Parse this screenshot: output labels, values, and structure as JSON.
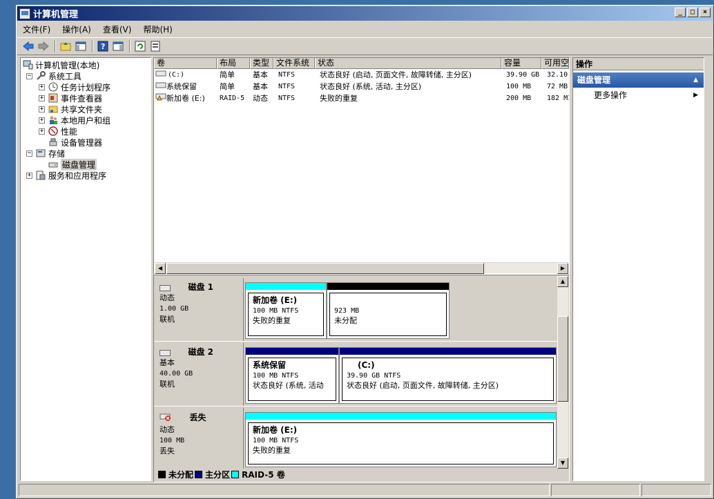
{
  "window": {
    "title": "计算机管理",
    "buttons": [
      "_",
      "□",
      "×"
    ]
  },
  "menu": [
    "文件(F)",
    "操作(A)",
    "查看(V)",
    "帮助(H)"
  ],
  "toolbar": [
    "back-icon",
    "forward-icon",
    "up-folder-icon",
    "show-hide-tree-icon",
    "help-icon",
    "show-hide-action-icon",
    "refresh-icon",
    "properties-icon"
  ],
  "tree": {
    "root": "计算机管理(本地)",
    "system_tools": "系统工具",
    "task_scheduler": "任务计划程序",
    "event_viewer": "事件查看器",
    "shared_folders": "共享文件夹",
    "local_users": "本地用户和组",
    "performance": "性能",
    "device_manager": "设备管理器",
    "storage": "存储",
    "disk_management": "磁盘管理",
    "services_apps": "服务和应用程序"
  },
  "volume_list": {
    "headers": [
      "卷",
      "布局",
      "类型",
      "文件系统",
      "状态",
      "容量",
      "可用空"
    ],
    "rows": [
      [
        "(C:)",
        "简单",
        "基本",
        "NTFS",
        "状态良好 (启动, 页面文件, 故障转储, 主分区)",
        "39.90 GB",
        "32.10"
      ],
      [
        "系统保留",
        "简单",
        "基本",
        "NTFS",
        "状态良好 (系统, 活动, 主分区)",
        "100 MB",
        "72 MB"
      ],
      [
        "新加卷 (E:)",
        "RAID-5",
        "动态",
        "NTFS",
        "失败的重复",
        "200 MB",
        "182 MI"
      ]
    ]
  },
  "disks": [
    {
      "name": "磁盘 1",
      "type": "动态",
      "size": "1.00 GB",
      "status": "联机",
      "partitions": [
        {
          "title": "新加卷  (E:)",
          "line1": "100 MB NTFS",
          "line2": "失败的重复",
          "color": "#00ffff"
        },
        {
          "title": "",
          "line1": "923 MB",
          "line2": "未分配",
          "color": "#000000"
        }
      ]
    },
    {
      "name": "磁盘 2",
      "type": "基本",
      "size": "40.00 GB",
      "status": "联机",
      "partitions": [
        {
          "title": "系统保留",
          "line1": "100 MB NTFS",
          "line2": "状态良好 (系统, 活动",
          "color": "#000080"
        },
        {
          "title": "(C:)",
          "line1": "39.90 GB NTFS",
          "line2": "状态良好 (启动, 页面文件, 故障转储, 主分区)",
          "color": "#000080"
        }
      ]
    },
    {
      "name": "丢失",
      "type": "动态",
      "size": "100 MB",
      "status": "丢失",
      "partitions": [
        {
          "title": "新加卷  (E:)",
          "line1": "100 MB NTFS",
          "line2": "失败的重复",
          "color": "#00ffff"
        }
      ]
    }
  ],
  "legend": [
    {
      "label": "未分配",
      "color": "#000000"
    },
    {
      "label": "主分区",
      "color": "#000080"
    },
    {
      "label": "RAID-5 卷",
      "color": "#00ffff"
    }
  ],
  "actions": {
    "header": "操作",
    "section": "磁盘管理",
    "more": "更多操作"
  }
}
